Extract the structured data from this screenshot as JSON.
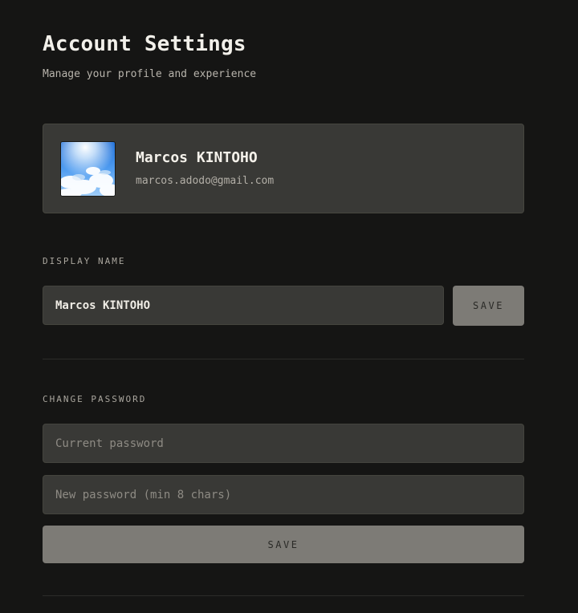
{
  "header": {
    "title": "Account Settings",
    "subtitle": "Manage your profile and experience"
  },
  "profile": {
    "name": "Marcos KINTOHO",
    "email": "marcos.adodo@gmail.com",
    "avatar_icon": "sky-clouds-avatar"
  },
  "display_name_section": {
    "label": "DISPLAY NAME",
    "value": "Marcos KINTOHO",
    "save_label": "SAVE"
  },
  "password_section": {
    "label": "CHANGE PASSWORD",
    "current_placeholder": "Current password",
    "new_placeholder": "New password (min 8 chars)",
    "save_label": "SAVE"
  },
  "colors": {
    "background": "#151514",
    "card": "#393936",
    "button": "#7d7b76"
  }
}
